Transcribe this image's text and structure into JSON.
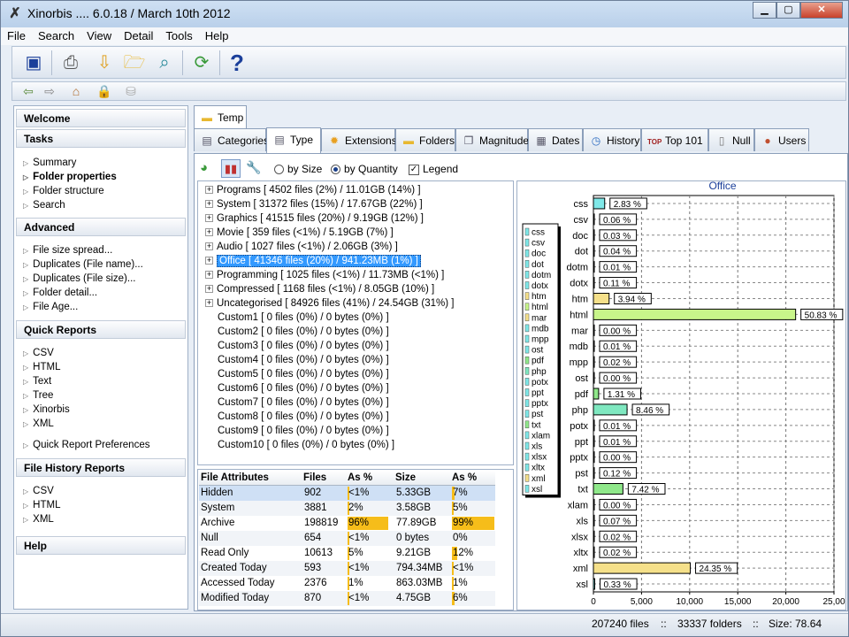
{
  "window": {
    "title": "Xinorbis .... 6.0.18 / March 10th 2012"
  },
  "menu": [
    "File",
    "Search",
    "View",
    "Detail",
    "Tools",
    "Help"
  ],
  "sidebar": {
    "sections": [
      {
        "title": "Welcome",
        "items": []
      },
      {
        "title": "Tasks",
        "items": [
          "Summary",
          "Folder properties",
          "Folder structure",
          "Search"
        ]
      },
      {
        "title": "Advanced",
        "items": [
          "File size spread...",
          "Duplicates (File name)...",
          "Duplicates (File size)...",
          "Folder detail...",
          "File Age..."
        ]
      },
      {
        "title": "Quick Reports",
        "items": [
          "CSV",
          "HTML",
          "Text",
          "Tree",
          "Xinorbis",
          "XML",
          "Quick Report Preferences"
        ]
      },
      {
        "title": "File History Reports",
        "items": [
          "CSV",
          "HTML",
          "XML"
        ]
      },
      {
        "title": "Help",
        "items": []
      }
    ]
  },
  "tabs_top": [
    "Temp"
  ],
  "tabs": [
    "Categories",
    "Type",
    "Extensions",
    "Folders",
    "Magnitude",
    "Dates",
    "History",
    "Top 101",
    "Null",
    "Users"
  ],
  "options": {
    "by_size": "by Size",
    "by_quantity": "by Quantity",
    "legend": "Legend"
  },
  "tree": [
    "Programs [ 4502 files (2%) / 11.01GB (14%) ]",
    "System [ 31372 files (15%) / 17.67GB (22%) ]",
    "Graphics [ 41515 files (20%) / 9.19GB (12%) ]",
    "Movie [ 359 files (<1%) / 5.19GB (7%) ]",
    "Audio [ 1027 files (<1%) / 2.06GB (3%) ]",
    "Office [ 41346 files (20%) / 941.23MB (1%) ]",
    "Programming [ 1025 files (<1%) / 11.73MB (<1%) ]",
    "Compressed [ 1168 files (<1%) / 8.05GB (10%) ]",
    "Uncategorised [ 84926 files (41%) / 24.54GB (31%) ]",
    "Custom1 [ 0 files (0%) / 0 bytes (0%) ]",
    "Custom2 [ 0 files (0%) / 0 bytes (0%) ]",
    "Custom3 [ 0 files (0%) / 0 bytes (0%) ]",
    "Custom4 [ 0 files (0%) / 0 bytes (0%) ]",
    "Custom5 [ 0 files (0%) / 0 bytes (0%) ]",
    "Custom6 [ 0 files (0%) / 0 bytes (0%) ]",
    "Custom7 [ 0 files (0%) / 0 bytes (0%) ]",
    "Custom8 [ 0 files (0%) / 0 bytes (0%) ]",
    "Custom9 [ 0 files (0%) / 0 bytes (0%) ]",
    "Custom10 [ 0 files (0%) / 0 bytes (0%) ]"
  ],
  "attributes": {
    "headers": [
      "File Attributes",
      "Files",
      "As %",
      "Size",
      "As %"
    ],
    "rows": [
      {
        "name": "Hidden",
        "files": "902",
        "pct_files": "<1%",
        "size": "5.33GB",
        "pct_size": "7%",
        "bar_files": 0.004,
        "bar_size": 0.07
      },
      {
        "name": "System",
        "files": "3881",
        "pct_files": "2%",
        "size": "3.58GB",
        "pct_size": "5%",
        "bar_files": 0.02,
        "bar_size": 0.05
      },
      {
        "name": "Archive",
        "files": "198819",
        "pct_files": "96%",
        "size": "77.89GB",
        "pct_size": "99%",
        "bar_files": 0.96,
        "bar_size": 0.99
      },
      {
        "name": "Null",
        "files": "654",
        "pct_files": "<1%",
        "size": "0 bytes",
        "pct_size": "0%",
        "bar_files": 0.003,
        "bar_size": 0
      },
      {
        "name": "Read Only",
        "files": "10613",
        "pct_files": "5%",
        "size": "9.21GB",
        "pct_size": "12%",
        "bar_files": 0.05,
        "bar_size": 0.12
      },
      {
        "name": "Created Today",
        "files": "593",
        "pct_files": "<1%",
        "size": "794.34MB",
        "pct_size": "<1%",
        "bar_files": 0.003,
        "bar_size": 0.01
      },
      {
        "name": "Accessed Today",
        "files": "2376",
        "pct_files": "1%",
        "size": "863.03MB",
        "pct_size": "1%",
        "bar_files": 0.01,
        "bar_size": 0.01
      },
      {
        "name": "Modified Today",
        "files": "870",
        "pct_files": "<1%",
        "size": "4.75GB",
        "pct_size": "6%",
        "bar_files": 0.004,
        "bar_size": 0.06
      }
    ]
  },
  "chart_data": {
    "type": "bar",
    "orientation": "horizontal",
    "title": "Office",
    "categories": [
      "css",
      "csv",
      "doc",
      "dot",
      "dotm",
      "dotx",
      "htm",
      "html",
      "mar",
      "mdb",
      "mpp",
      "ost",
      "pdf",
      "php",
      "potx",
      "ppt",
      "pptx",
      "pst",
      "txt",
      "xlam",
      "xls",
      "xlsx",
      "xltx",
      "xml",
      "xsl"
    ],
    "values": [
      1171,
      25,
      12,
      17,
      4,
      45,
      1629,
      21016,
      0,
      4,
      8,
      0,
      542,
      3498,
      4,
      4,
      0,
      50,
      3068,
      0,
      29,
      8,
      8,
      10068,
      136
    ],
    "labels": [
      "2.83 %",
      "0.06 %",
      "0.03 %",
      "0.04 %",
      "0.01 %",
      "0.11 %",
      "3.94 %",
      "50.83 %",
      "0.00 %",
      "0.01 %",
      "0.02 %",
      "0.00 %",
      "1.31 %",
      "8.46 %",
      "0.01 %",
      "0.01 %",
      "0.00 %",
      "0.12 %",
      "7.42 %",
      "0.00 %",
      "0.07 %",
      "0.02 %",
      "0.02 %",
      "24.35 %",
      "0.33 %"
    ],
    "colors": [
      "#7fe8e8",
      "#7fe8e8",
      "#7fe8e8",
      "#7fe8e8",
      "#7fe8e8",
      "#7fe8e8",
      "#f5e08a",
      "#c8f58a",
      "#f5e08a",
      "#7fe8e8",
      "#7fe8e8",
      "#7fe8e8",
      "#8fe88a",
      "#7fe8c0",
      "#7fe8e8",
      "#7fe8e8",
      "#7fe8e8",
      "#7fe8e8",
      "#8fe88a",
      "#7fe8e8",
      "#7fe8e8",
      "#7fe8e8",
      "#7fe8e8",
      "#f5e08a",
      "#7fe8e8"
    ],
    "xticks": [
      "0",
      "5,000",
      "10,000",
      "15,000",
      "20,000",
      "25,00"
    ],
    "xlim": [
      0,
      25000
    ],
    "legend": [
      "css",
      "csv",
      "doc",
      "dot",
      "dotm",
      "dotx",
      "htm",
      "html",
      "mar",
      "mdb",
      "mpp",
      "ost",
      "pdf",
      "php",
      "potx",
      "ppt",
      "pptx",
      "pst",
      "txt",
      "xlam",
      "xls",
      "xlsx",
      "xltx",
      "xml",
      "xsl"
    ],
    "legend_position": "left",
    "grid": true
  },
  "status": {
    "files": "207240 files",
    "folders": "33337 folders",
    "size": "Size: 78.64",
    "sep": "::"
  }
}
